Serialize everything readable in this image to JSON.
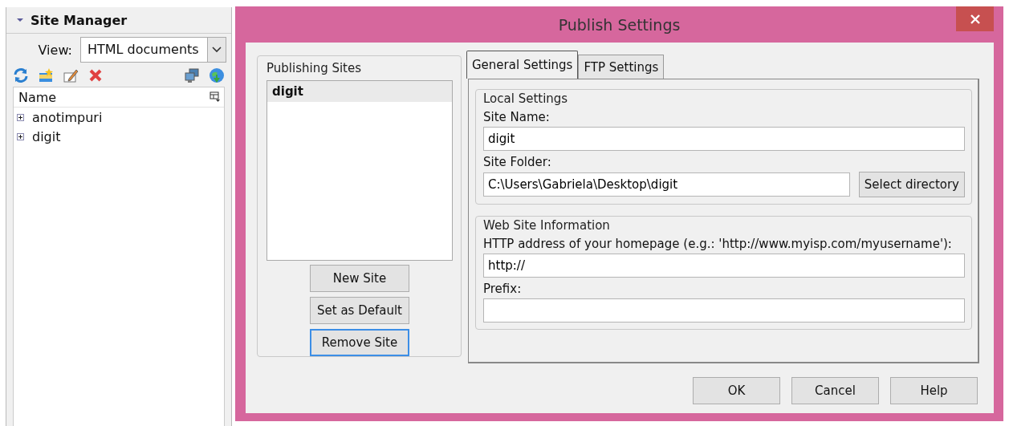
{
  "site_manager": {
    "title": "Site Manager",
    "view_label": "View:",
    "view_value": "HTML documents",
    "column": "Name",
    "tree": [
      {
        "label": "anotimpuri",
        "expanded": false
      },
      {
        "label": "digit",
        "expanded": false
      }
    ]
  },
  "dialog": {
    "title": "Publish Settings",
    "publishing_sites": {
      "title": "Publishing Sites",
      "sites": [
        {
          "label": "digit",
          "selected": true
        }
      ],
      "buttons": [
        {
          "label": "New Site",
          "focused": false
        },
        {
          "label": "Set as Default",
          "focused": false
        },
        {
          "label": "Remove Site",
          "focused": true
        }
      ]
    },
    "tabs": [
      {
        "label": "General Settings",
        "selected": true
      },
      {
        "label": "FTP Settings",
        "selected": false
      }
    ],
    "groups": [
      {
        "title": "Local Settings",
        "fields": [
          {
            "label": "Site Name:",
            "value": "digit"
          },
          {
            "label": "Site Folder:",
            "value": "C:\\Users\\Gabriela\\Desktop\\digit",
            "button": "Select directory"
          }
        ]
      },
      {
        "title": "Web Site Information",
        "fields": [
          {
            "label": "HTTP address of your homepage (e.g.: 'http://www.myisp.com/myusername'):",
            "value": "http://"
          },
          {
            "label": "Prefix:"
          }
        ]
      }
    ],
    "buttons": [
      "OK",
      "Cancel",
      "Help"
    ]
  }
}
